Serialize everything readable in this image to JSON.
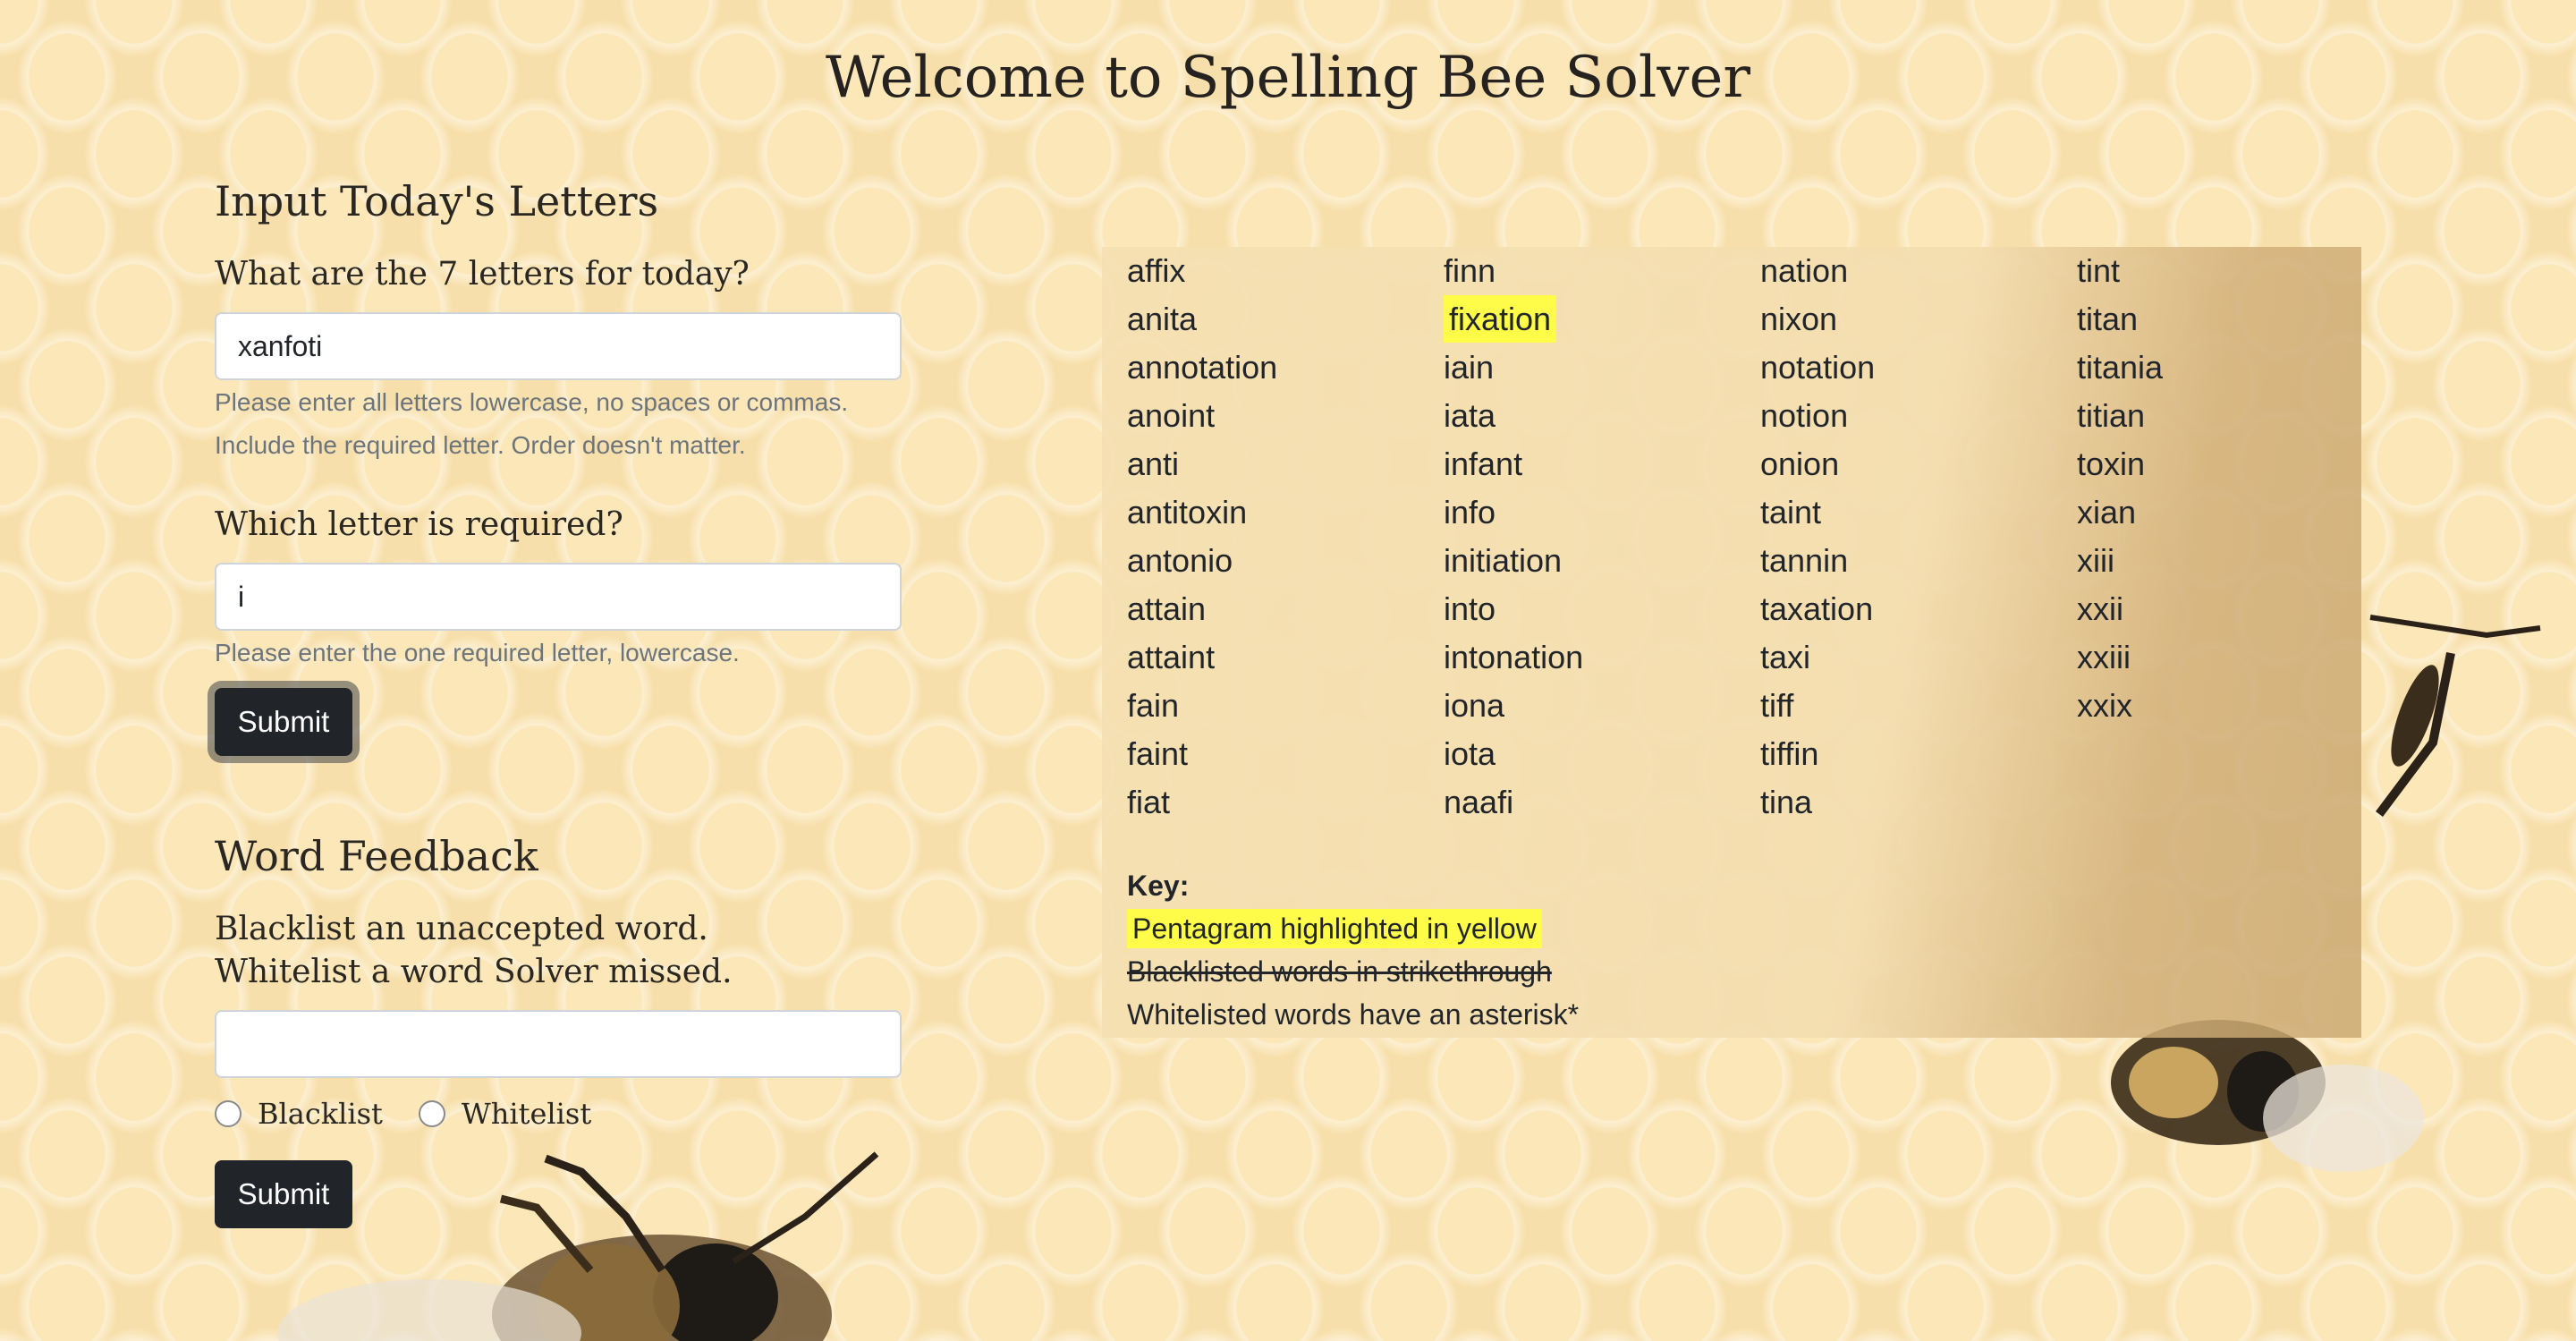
{
  "page": {
    "title": "Welcome to Spelling Bee Solver"
  },
  "letters_form": {
    "heading": "Input Today's Letters",
    "letters_label": "What are the 7 letters for today?",
    "letters_value": "xanfoti",
    "letters_help_1": "Please enter all letters lowercase, no spaces or commas.",
    "letters_help_2": "Include the required letter. Order doesn't matter.",
    "required_label": "Which letter is required?",
    "required_value": "i",
    "required_help": "Please enter the one required letter, lowercase.",
    "submit_label": "Submit"
  },
  "feedback_form": {
    "heading": "Word Feedback",
    "desc_1": "Blacklist an unaccepted word.",
    "desc_2": "Whitelist a word Solver missed.",
    "word_value": "",
    "blacklist_label": "Blacklist",
    "whitelist_label": "Whitelist",
    "submit_label": "Submit"
  },
  "results": {
    "columns": [
      [
        "affix",
        "anita",
        "annotation",
        "anoint",
        "anti",
        "antitoxin",
        "antonio",
        "attain",
        "attaint",
        "fain",
        "faint",
        "fiat"
      ],
      [
        "finn",
        "fixation",
        "iain",
        "iata",
        "infant",
        "info",
        "initiation",
        "into",
        "intonation",
        "iona",
        "iota",
        "naafi"
      ],
      [
        "nation",
        "nixon",
        "notation",
        "notion",
        "onion",
        "taint",
        "tannin",
        "taxation",
        "taxi",
        "tiff",
        "tiffin",
        "tina"
      ],
      [
        "tint",
        "titan",
        "titania",
        "titian",
        "toxin",
        "xian",
        "xiii",
        "xxii",
        "xxiii",
        "xxix"
      ]
    ],
    "pentagrams": [
      "fixation"
    ],
    "key": {
      "title": "Key:",
      "pentagram": "Pentagram highlighted in yellow",
      "blacklisted": "Blacklisted words in strikethrough",
      "whitelisted": "Whitelisted words have an asterisk*"
    }
  }
}
